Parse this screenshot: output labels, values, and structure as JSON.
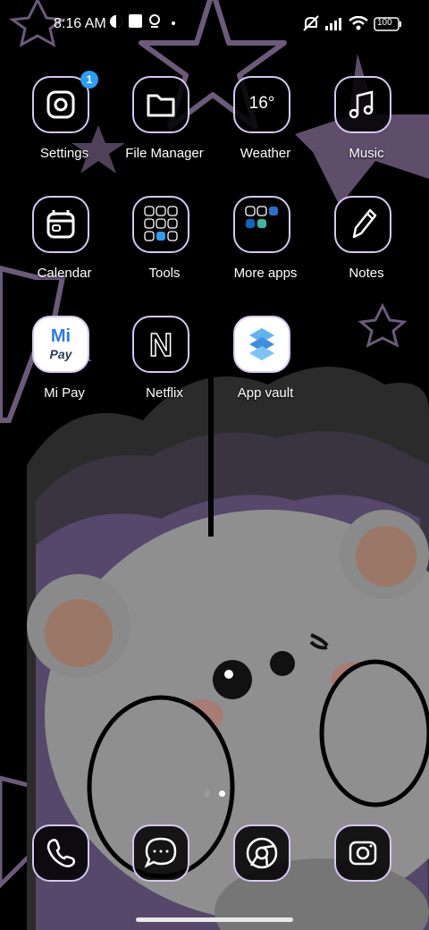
{
  "status": {
    "time": "8:16 AM",
    "battery": "100",
    "icons": [
      "face-icon",
      "square-icon",
      "location-pin-icon",
      "dot-icon",
      "mute-icon",
      "signal-icon",
      "wifi-icon",
      "battery-icon"
    ]
  },
  "apps": [
    {
      "label": "Settings",
      "icon": "settings-icon",
      "badge": "1"
    },
    {
      "label": "File Manager",
      "icon": "folder-icon"
    },
    {
      "label": "Weather",
      "icon": "weather-icon",
      "temp": "16°"
    },
    {
      "label": "Music",
      "icon": "music-note-icon"
    },
    {
      "label": "Calendar",
      "icon": "calendar-icon"
    },
    {
      "label": "Tools",
      "icon": "tools-folder-icon"
    },
    {
      "label": "More apps",
      "icon": "more-apps-folder-icon"
    },
    {
      "label": "Notes",
      "icon": "pencil-icon"
    },
    {
      "label": "Mi Pay",
      "icon": "mi-pay-icon",
      "logo_top": "Mi",
      "logo_bottom": "Pay"
    },
    {
      "label": "Netflix",
      "icon": "netflix-icon",
      "logo": "N"
    },
    {
      "label": "App vault",
      "icon": "app-vault-icon"
    }
  ],
  "dock": [
    {
      "icon": "phone-icon"
    },
    {
      "icon": "messages-icon"
    },
    {
      "icon": "chrome-icon"
    },
    {
      "icon": "camera-icon"
    }
  ],
  "pager": {
    "pages": 2,
    "active": 2
  }
}
